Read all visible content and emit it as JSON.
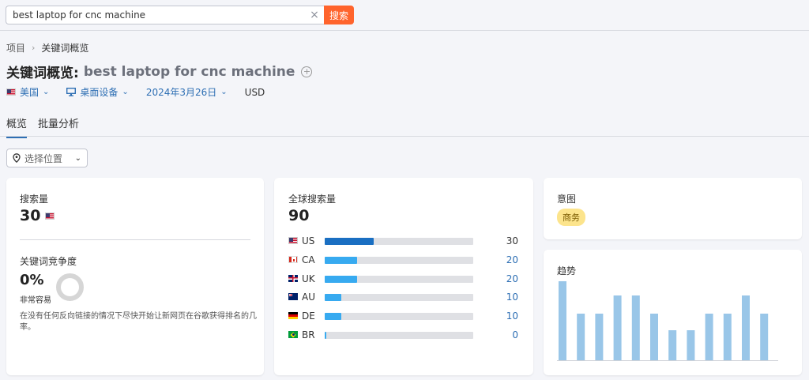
{
  "search": {
    "value": "best laptop for cnc machine",
    "clear_glyph": "×",
    "button_label": "搜索"
  },
  "breadcrumb": {
    "root": "项目",
    "separator": "›",
    "current": "关键词概览"
  },
  "page_title": {
    "label": "关键词概览:",
    "keyword": "best laptop for cnc machine"
  },
  "filters": {
    "country": "美国",
    "device": "桌面设备",
    "date": "2024年3月26日",
    "currency": "USD"
  },
  "tabs": [
    "概览",
    "批量分析"
  ],
  "location_button": "选择位置",
  "volume_card": {
    "label": "搜索量",
    "value": "30",
    "kd_label": "关键词竞争度",
    "kd_value": "0%",
    "kd_level": "非常容易",
    "kd_description": "在没有任何反向链接的情况下尽快开始让新网页在谷歌获得排名的几率。"
  },
  "global_card": {
    "label": "全球搜索量",
    "value": "90",
    "countries": [
      {
        "code": "US",
        "flag": "flag-us",
        "value": "30",
        "ratio": 0.33,
        "color": "#1a6fc2"
      },
      {
        "code": "CA",
        "flag": "flag-ca",
        "value": "20",
        "ratio": 0.22,
        "color": "#37aaf0"
      },
      {
        "code": "UK",
        "flag": "flag-uk",
        "value": "20",
        "ratio": 0.22,
        "color": "#37aaf0"
      },
      {
        "code": "AU",
        "flag": "flag-au",
        "value": "10",
        "ratio": 0.11,
        "color": "#37aaf0"
      },
      {
        "code": "DE",
        "flag": "flag-de",
        "value": "10",
        "ratio": 0.11,
        "color": "#37aaf0"
      },
      {
        "code": "BR",
        "flag": "flag-br",
        "value": "0",
        "ratio": 0.01,
        "color": "#37aaf0"
      }
    ]
  },
  "intent_card": {
    "label": "意图",
    "badge": "商务"
  },
  "trend_card": {
    "label": "趋势"
  },
  "chart_data": {
    "type": "bar",
    "title": "趋势",
    "xlabel": "",
    "ylabel": "",
    "ylim": [
      0,
      1
    ],
    "values": [
      1.0,
      0.59,
      0.59,
      0.82,
      0.82,
      0.59,
      0.38,
      0.38,
      0.59,
      0.59,
      0.82,
      0.59
    ],
    "color": "#99c6e8",
    "grid": false
  }
}
